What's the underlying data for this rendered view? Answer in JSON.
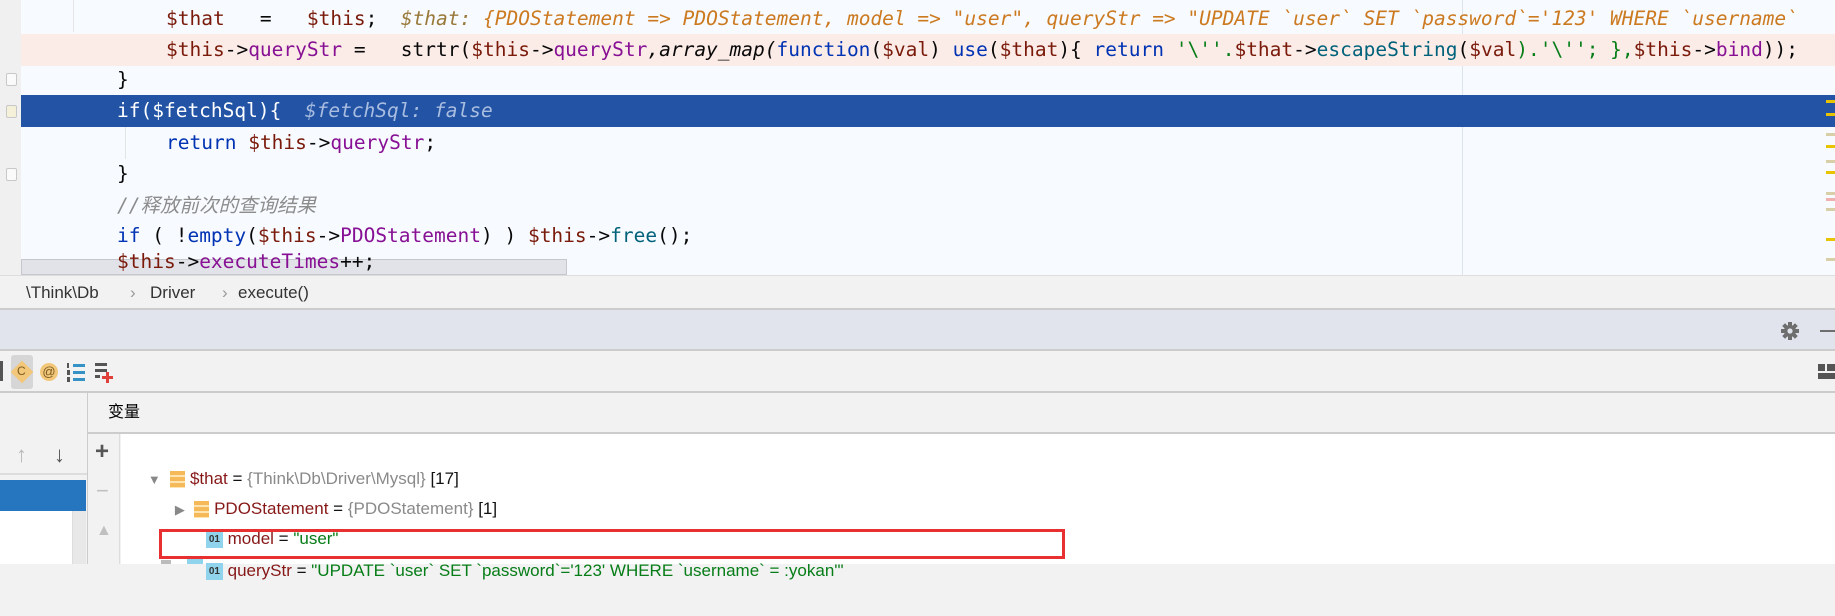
{
  "editor": {
    "line1": {
      "code_a": "$that",
      "code_b": "   =   ",
      "code_c": "$this",
      "code_d": ";  ",
      "hint_label": "$that: ",
      "hint_value": "{PDOStatement => PDOStatement, model => \"user\", queryStr => \"UPDATE `user` SET `password`='123' WHERE `username`"
    },
    "line2": {
      "a": "$this",
      "b": "->",
      "c": "queryStr",
      "d": " =   strtr(",
      "e": "$this",
      "f": "->",
      "g": "queryStr",
      "h": ",array_map(",
      "i": "function",
      "j": "(",
      "k": "$val",
      "l": ") ",
      "m": "use",
      "n": "(",
      "o": "$that",
      "p": "){ ",
      "q": "return",
      "r": " '\\''.",
      "s": "$that",
      "t": "->",
      "u": "escapeString",
      "v": "(",
      "w": "$val",
      "x": ").'\\''; },",
      "y": "$this",
      "z": "->",
      "aa": "bind",
      "ab": "));"
    },
    "line3": "}",
    "line4": {
      "code": "if($fetchSql){",
      "hint": "$fetchSql: false"
    },
    "line5": {
      "kw": "return",
      "sp": " ",
      "var": "$this",
      "arrow": "->",
      "prop": "queryStr",
      "end": ";"
    },
    "line6": "}",
    "line7": "//释放前次的查询结果",
    "line8": {
      "kw": "if",
      "a": " ( !",
      "fn": "empty",
      "b": "(",
      "v": "$this",
      "c": "->",
      "p": "PDOStatement",
      "d": ") ) ",
      "v2": "$this",
      "e": "->",
      "m": "free",
      "f": "();"
    },
    "line9": {
      "v": "$this",
      "a": "->",
      "p": "executeTimes",
      "b": "++;"
    }
  },
  "breadcrumb": [
    "\\Think\\Db",
    "Driver",
    "execute()"
  ],
  "breadcrumb_sep": "›",
  "variables_header": "变量",
  "tree": [
    {
      "name": "$that",
      "eq": " = ",
      "type": "{Think\\Db\\Driver\\Mysql}",
      "count": " [17]",
      "expanded": true
    },
    {
      "name": "PDOStatement",
      "eq": " = ",
      "type": "{PDOStatement}",
      "count": " [1]",
      "expanded": false
    },
    {
      "icon": "01",
      "name": "model",
      "eq": " = ",
      "value": "\"user\""
    },
    {
      "icon": "01",
      "name": "queryStr",
      "eq": " = ",
      "value": "\"UPDATE `user` SET `password`='123' WHERE `username` = :yokan'\""
    }
  ],
  "icons": {
    "toolbar": [
      "class-icon",
      "at-icon",
      "numbered-list-icon",
      "add-watch-icon"
    ],
    "header": [
      "gear-icon",
      "minimize-icon"
    ]
  },
  "colors": {
    "highlight": "#2253a5",
    "frame_selected": "#2675bf",
    "annotation_box": "#e83030"
  },
  "glyphs": {
    "plus": "+",
    "minus": "−",
    "up": "▲",
    "arrow_up": "↑",
    "arrow_down": "↓",
    "expanded": "▼",
    "collapsed": "▶",
    "class": "C",
    "at": "@"
  }
}
